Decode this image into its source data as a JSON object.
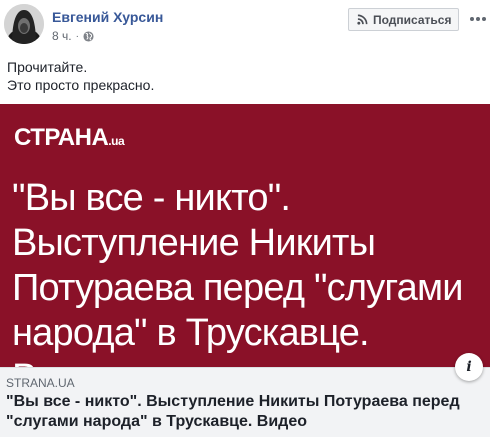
{
  "author": {
    "name": "Евгений Хурсин",
    "time": "8 ч.",
    "separator": "·"
  },
  "actions": {
    "subscribe_label": "Подписаться"
  },
  "post": {
    "lines": [
      "Прочитайте.",
      "Это просто прекрасно."
    ]
  },
  "banner": {
    "brand": "СТРАНА",
    "brand_suffix": ".ua",
    "headline": "\"Вы все - никто\". Выступление Никиты Потураева перед \"слугами народа\" в Трускавце. Видео",
    "background": "#8a1128"
  },
  "link": {
    "domain": "STRANA.UA",
    "title": "\"Вы все - никто\". Выступление Никиты Потураева перед \"слугами народа\" в Трускавце. Видео"
  },
  "icons": {
    "audience": "globe-icon",
    "subscribe": "rss-icon",
    "more": "more-icon",
    "info": "info-icon"
  }
}
